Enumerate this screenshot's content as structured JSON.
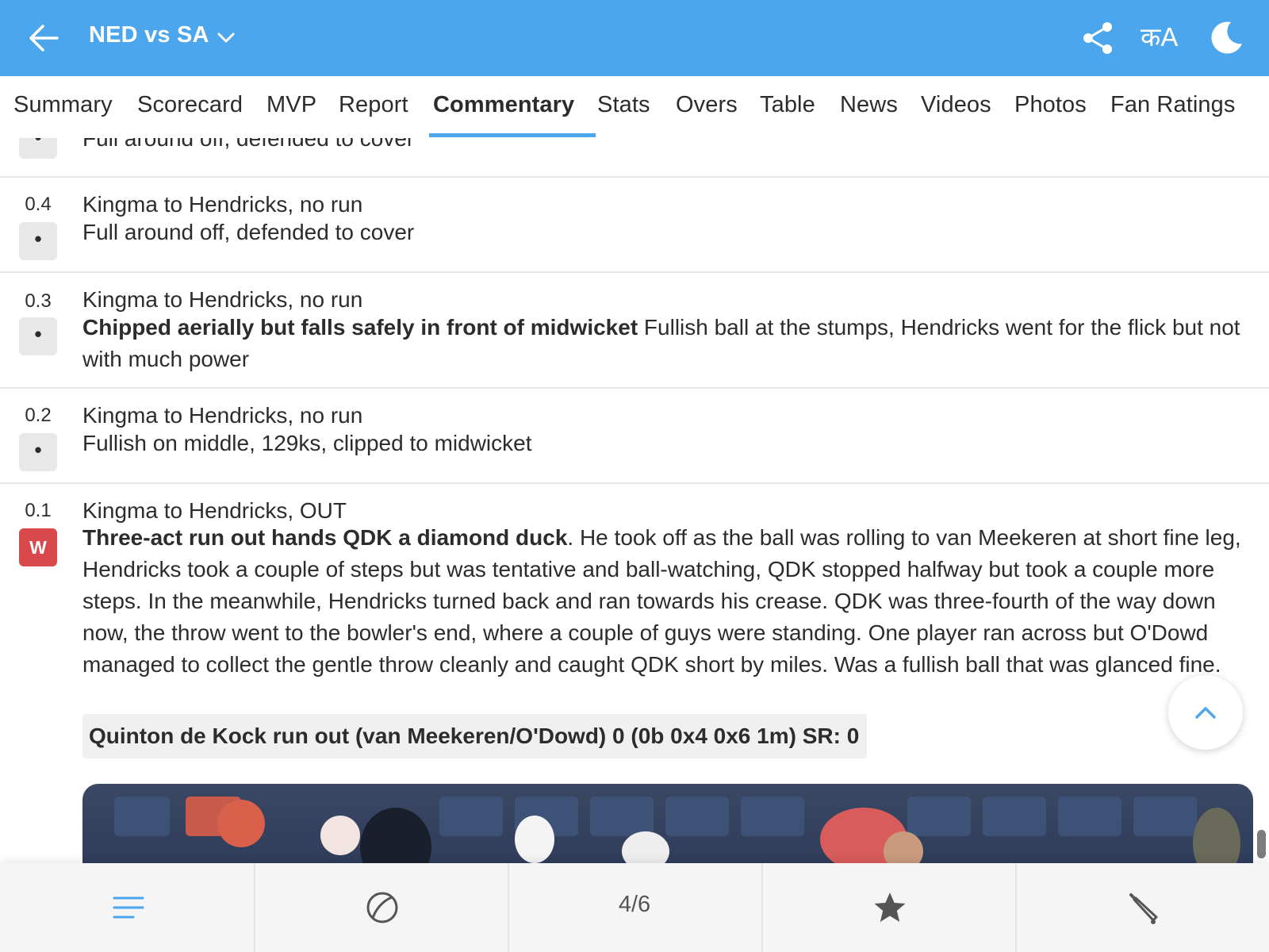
{
  "header": {
    "title": "NED vs SA",
    "lang_label": "कA",
    "icons": {
      "back": "back-arrow-icon",
      "dropdown": "chevron-down-icon",
      "share": "share-icon",
      "language": "language-icon",
      "theme": "moon-icon"
    }
  },
  "tabs": [
    {
      "label": "Summary"
    },
    {
      "label": "Scorecard"
    },
    {
      "label": "MVP"
    },
    {
      "label": "Report"
    },
    {
      "label": "Commentary",
      "active": true
    },
    {
      "label": "Stats"
    },
    {
      "label": "Overs"
    },
    {
      "label": "Table"
    },
    {
      "label": "News"
    },
    {
      "label": "Videos"
    },
    {
      "label": "Photos"
    },
    {
      "label": "Fan Ratings"
    }
  ],
  "commentary": [
    {
      "over": "",
      "result": "•",
      "headline": "",
      "text": "Full around off, defended to cover"
    },
    {
      "over": "0.4",
      "result": "•",
      "headline": "Kingma to Hendricks, no run",
      "text": "Full around off, defended to cover"
    },
    {
      "over": "0.3",
      "result": "•",
      "headline": "Kingma to Hendricks, no run",
      "bold": "Chipped aerially but falls safely in front of midwicket",
      "text": "Fullish ball at the stumps, Hendricks went for the flick but not with much power"
    },
    {
      "over": "0.2",
      "result": "•",
      "headline": "Kingma to Hendricks, no run",
      "text": "Fullish on middle, 129ks, clipped to midwicket"
    },
    {
      "over": "0.1",
      "result": "W",
      "headline": "Kingma to Hendricks, OUT",
      "bold": "Three-act run out hands QDK a diamond duck",
      "text": ". He took off as the ball was rolling to van Meekeren at short fine leg, Hendricks took a couple of steps but was tentative and ball-watching, QDK stopped halfway but took a couple more steps. In the meanwhile, Hendricks turned back and ran towards his crease. QDK was three-fourth of the way down now, the throw went to the bowler's end, where a couple of guys were standing. One player ran across but O'Dowd managed to collect the gentle throw cleanly and caught QDK short by miles. Was a fullish ball that was glanced fine.",
      "dismissal": "Quinton de Kock run out (van Meekeren/O'Dowd) 0 (0b 0x4 0x6 1m) SR: 0"
    }
  ],
  "bottom_nav": {
    "page_indicator": "4/6",
    "icons": [
      "menu-icon",
      "ball-icon",
      "page-indicator",
      "star-icon",
      "bat-icon"
    ]
  },
  "colors": {
    "brand": "#4ba6ee",
    "wicket": "#d9484b",
    "dot_ball_bg": "#e8e8e8"
  }
}
